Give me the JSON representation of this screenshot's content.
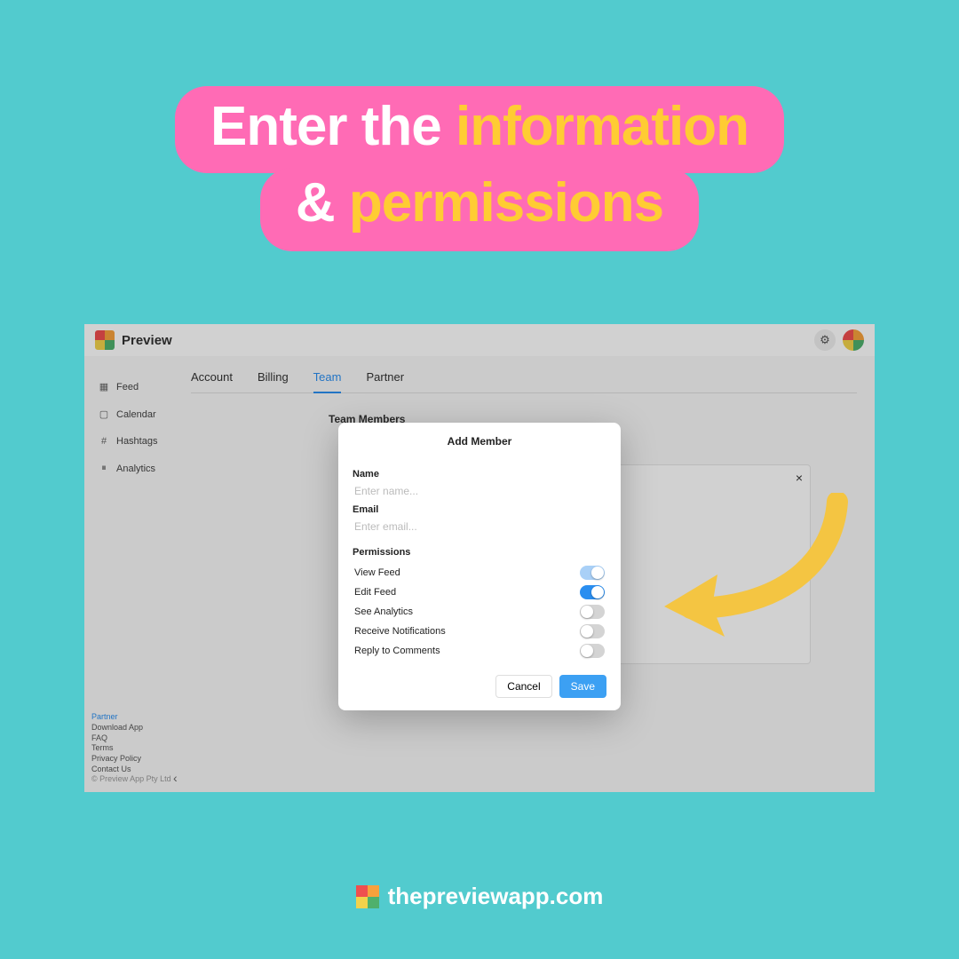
{
  "headline": {
    "l1_white": "Enter the ",
    "l1_yellow": "information",
    "l2_white": "& ",
    "l2_yellow": "permissions"
  },
  "app": {
    "title": "Preview",
    "gear_icon": "⚙",
    "sidebar": {
      "items": [
        {
          "icon": "▦",
          "label": "Feed"
        },
        {
          "icon": "▢",
          "label": "Calendar"
        },
        {
          "icon": "#",
          "label": "Hashtags"
        },
        {
          "icon": "⏸",
          "label": "Analytics"
        }
      ]
    },
    "tabs": [
      {
        "label": "Account",
        "active": false
      },
      {
        "label": "Billing",
        "active": false
      },
      {
        "label": "Team",
        "active": true
      },
      {
        "label": "Partner",
        "active": false
      }
    ],
    "section": "Team Members",
    "close_x": "×",
    "footer_links": [
      "Partner",
      "Download App",
      "FAQ",
      "Terms",
      "Privacy Policy",
      "Contact Us"
    ],
    "copyright": "© Preview App Pty Ltd",
    "chevron": "‹"
  },
  "modal": {
    "title": "Add Member",
    "name_label": "Name",
    "name_placeholder": "Enter name...",
    "email_label": "Email",
    "email_placeholder": "Enter email...",
    "perm_label": "Permissions",
    "permissions": [
      {
        "label": "View Feed",
        "state": "on-light"
      },
      {
        "label": "Edit Feed",
        "state": "on-blue"
      },
      {
        "label": "See Analytics",
        "state": "off"
      },
      {
        "label": "Receive Notifications",
        "state": "off"
      },
      {
        "label": "Reply to Comments",
        "state": "off"
      }
    ],
    "cancel": "Cancel",
    "save": "Save"
  },
  "brand": "thepreviewapp.com"
}
